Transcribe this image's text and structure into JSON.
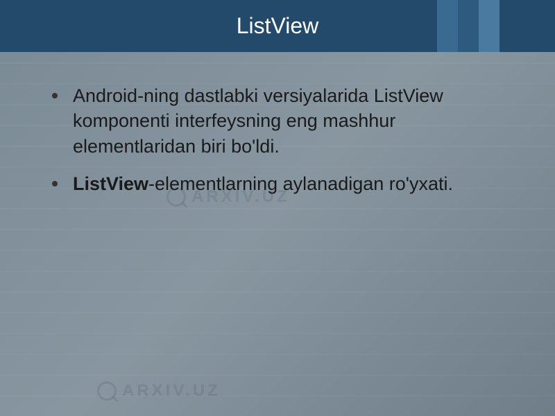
{
  "header": {
    "title": "ListView"
  },
  "watermark": {
    "text": "ARXIV.UZ"
  },
  "content": {
    "bullets": [
      {
        "text": "Android-ning dastlabki versiyalarida ListView komponenti interfeysning eng mashhur elementlaridan biri bo'ldi."
      },
      {
        "prefix_bold": "ListView",
        "suffix": "-elementlarning aylanadigan ro'yxati."
      }
    ]
  }
}
